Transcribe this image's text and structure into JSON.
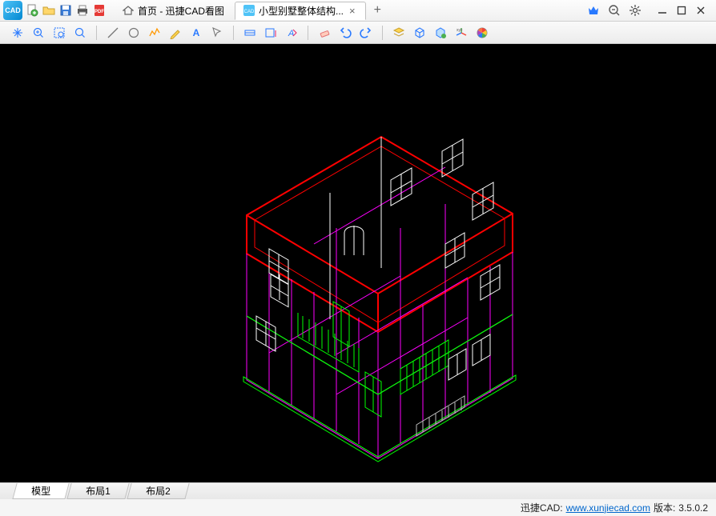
{
  "app": {
    "icon_text": "CAD"
  },
  "titlebar_buttons": [
    "new",
    "open",
    "save",
    "print",
    "pdf"
  ],
  "tabs": {
    "home": {
      "label": "首页 - 迅捷CAD看图"
    },
    "active": {
      "label": "小型别墅整体结构..."
    }
  },
  "window_controls": [
    "vip",
    "zoom-out",
    "settings",
    "minimize",
    "maximize",
    "close"
  ],
  "toolbar_groups": [
    [
      "pan",
      "zoom-extents",
      "zoom-window",
      "zoom-fit"
    ],
    [
      "line",
      "circle",
      "polyline",
      "pencil",
      "text",
      "select"
    ],
    [
      "dim-linear",
      "dim-aligned",
      "dim-annotate"
    ],
    [
      "eraser",
      "undo",
      "redo"
    ],
    [
      "layer",
      "3d-box",
      "3d-orbit",
      "xyz-axis",
      "color-wheel"
    ]
  ],
  "bottom_tabs": [
    "模型",
    "布局1",
    "布局2"
  ],
  "status": {
    "product": "迅捷CAD:",
    "url": "www.xunjiecad.com",
    "version_label": "版本:",
    "version": "3.5.0.2"
  }
}
